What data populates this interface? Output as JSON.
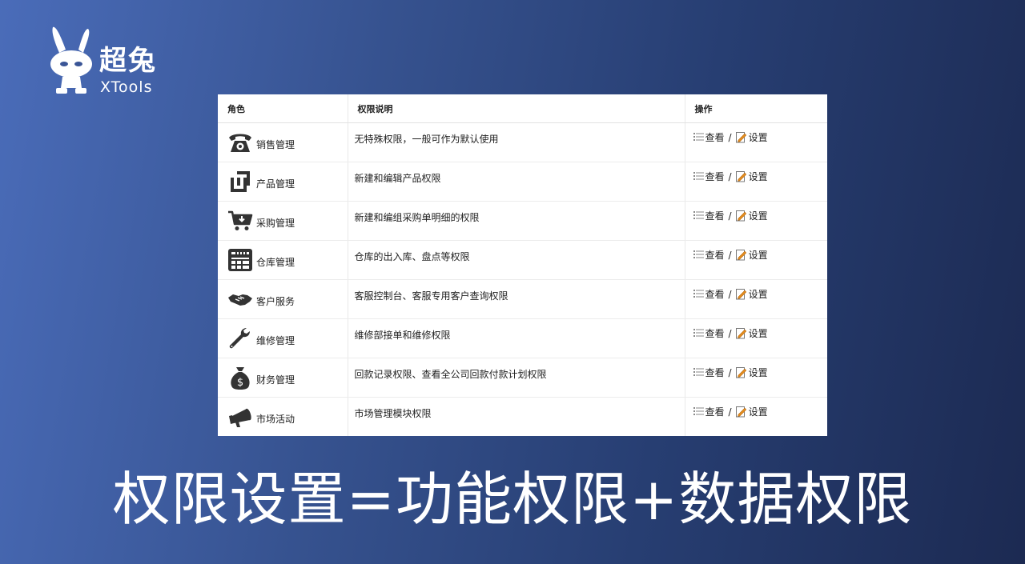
{
  "brand": {
    "name_cn": "超兔",
    "name_en": "XTools",
    "logo_icon": "rabbit-mascot-icon"
  },
  "table": {
    "headers": [
      "角色",
      "权限说明",
      "操作"
    ],
    "rows": [
      {
        "icon": "telephone-icon",
        "role": "销售管理",
        "desc": "无特殊权限，一般可作为默认使用",
        "view": "查看",
        "sep": "/",
        "set": "设置"
      },
      {
        "icon": "product-box-icon",
        "role": "产品管理",
        "desc": "新建和编辑产品权限",
        "view": "查看",
        "sep": "/",
        "set": "设置"
      },
      {
        "icon": "shopping-cart-icon",
        "role": "采购管理",
        "desc": "新建和编组采购单明细的权限",
        "view": "查看",
        "sep": "/",
        "set": "设置"
      },
      {
        "icon": "warehouse-icon",
        "role": "仓库管理",
        "desc": "仓库的出入库、盘点等权限",
        "view": "查看",
        "sep": "/",
        "set": "设置"
      },
      {
        "icon": "handshake-icon",
        "role": "客户服务",
        "desc": "客服控制台、客服专用客户查询权限",
        "view": "查看",
        "sep": "/",
        "set": "设置"
      },
      {
        "icon": "wrench-icon",
        "role": "维修管理",
        "desc": "维修部接单和维修权限",
        "view": "查看",
        "sep": "/",
        "set": "设置"
      },
      {
        "icon": "money-bag-icon",
        "role": "财务管理",
        "desc": "回款记录权限、查看全公司回款付款计划权限",
        "view": "查看",
        "sep": "/",
        "set": "设置"
      },
      {
        "icon": "megaphone-icon",
        "role": "市场活动",
        "desc": "市场管理模块权限",
        "view": "查看",
        "sep": "/",
        "set": "设置"
      }
    ]
  },
  "headline": "权限设置=功能权限+数据权限",
  "colors": {
    "bg_start": "#4a6cb9",
    "bg_end": "#1c2a52",
    "icon_dark": "#333333",
    "edit_icon": "#e08a1e"
  }
}
